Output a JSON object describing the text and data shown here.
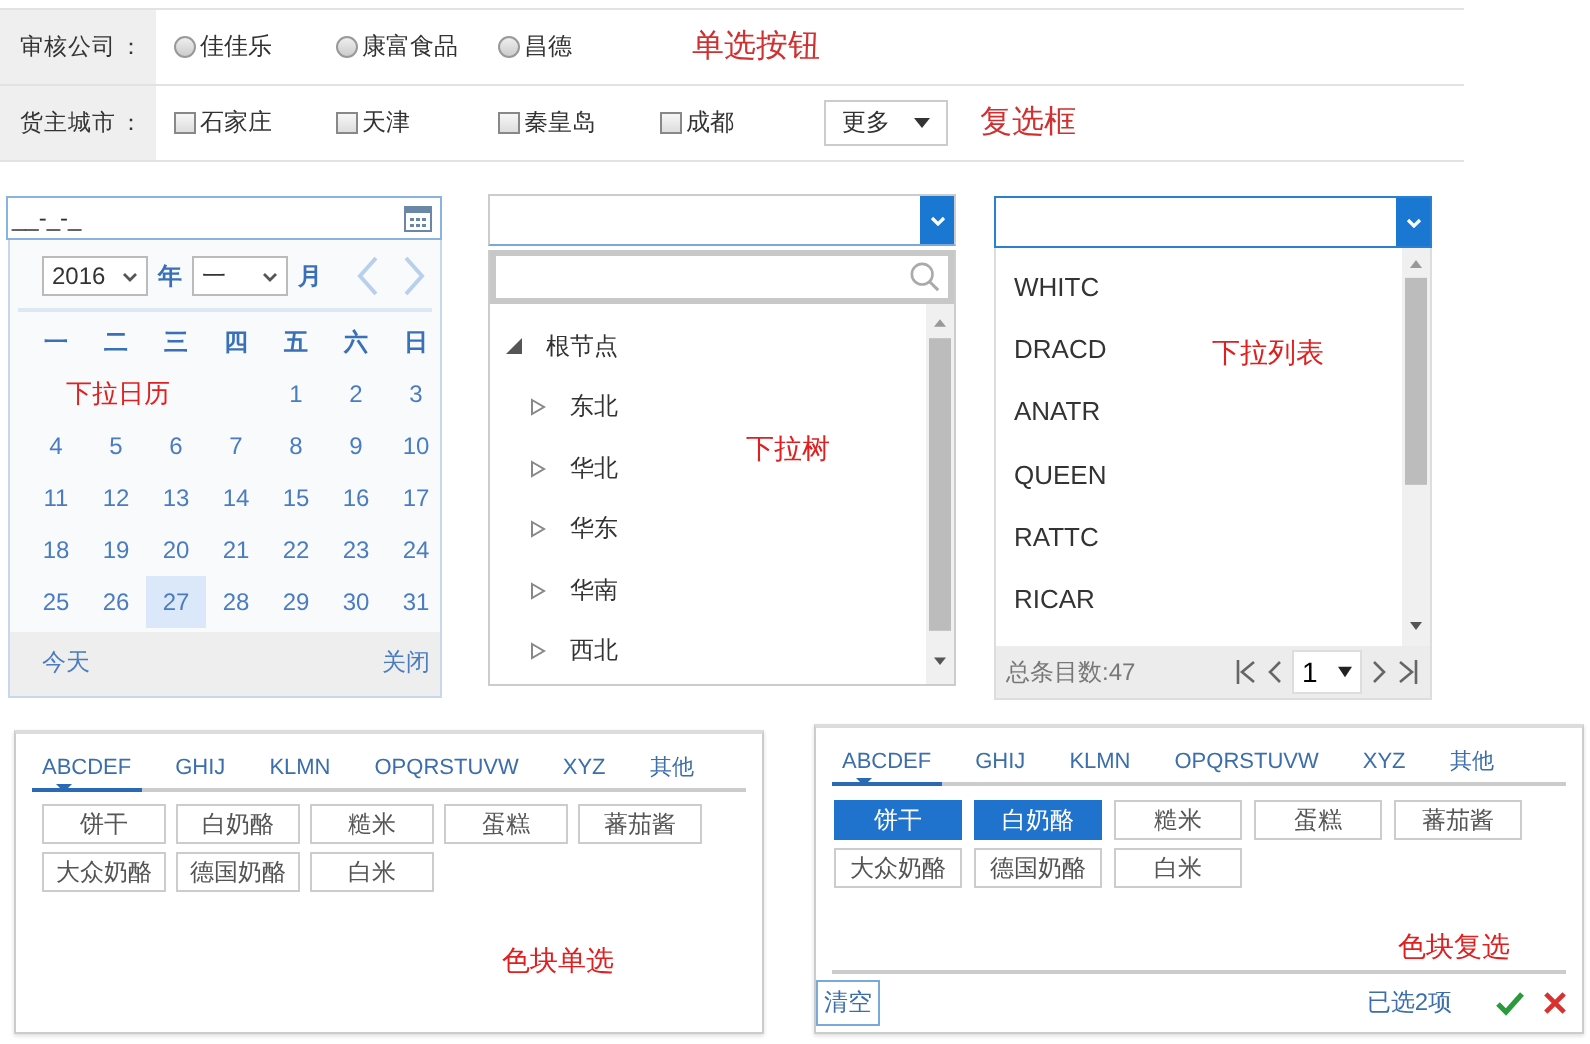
{
  "form": [
    {
      "label": "审核公司",
      "colon": "：",
      "kind": "radio",
      "options": [
        {
          "label": "佳佳乐",
          "selected": false
        },
        {
          "label": "康富食品",
          "selected": false
        },
        {
          "label": "昌德",
          "selected": false
        }
      ],
      "note": "单选按钮"
    },
    {
      "label": "货主城市",
      "colon": "：",
      "kind": "checkbox",
      "options": [
        {
          "label": "石家庄",
          "checked": false
        },
        {
          "label": "天津",
          "checked": false
        },
        {
          "label": "秦皇岛",
          "checked": false
        },
        {
          "label": "成都",
          "checked": false
        }
      ],
      "more": "更多",
      "note": "复选框"
    }
  ],
  "datepicker": {
    "value": "__-_-_",
    "year": "2016",
    "year_unit": "年",
    "month": "一",
    "month_unit": "月",
    "weekdays": [
      "一",
      "二",
      "三",
      "四",
      "五",
      "六",
      "日"
    ],
    "note": "下拉日历",
    "weeks": [
      [
        {
          "day": "1",
          "selected": false
        },
        {
          "day": "2",
          "selected": false
        },
        {
          "day": "3",
          "selected": false
        }
      ],
      [
        {
          "day": "4",
          "selected": false
        },
        {
          "day": "5",
          "selected": false
        },
        {
          "day": "6",
          "selected": false
        },
        {
          "day": "7",
          "selected": false
        },
        {
          "day": "8",
          "selected": false
        },
        {
          "day": "9",
          "selected": false
        },
        {
          "day": "10",
          "selected": false
        }
      ],
      [
        {
          "day": "11",
          "selected": false
        },
        {
          "day": "12",
          "selected": false
        },
        {
          "day": "13",
          "selected": false
        },
        {
          "day": "14",
          "selected": false
        },
        {
          "day": "15",
          "selected": false
        },
        {
          "day": "16",
          "selected": false
        },
        {
          "day": "17",
          "selected": false
        }
      ],
      [
        {
          "day": "18",
          "selected": false
        },
        {
          "day": "19",
          "selected": false
        },
        {
          "day": "20",
          "selected": false
        },
        {
          "day": "21",
          "selected": false
        },
        {
          "day": "22",
          "selected": false
        },
        {
          "day": "23",
          "selected": false
        },
        {
          "day": "24",
          "selected": false
        }
      ],
      [
        {
          "day": "25",
          "selected": false
        },
        {
          "day": "26",
          "selected": false
        },
        {
          "day": "27",
          "selected": true
        },
        {
          "day": "28",
          "selected": false
        },
        {
          "day": "29",
          "selected": false
        },
        {
          "day": "30",
          "selected": false
        },
        {
          "day": "31",
          "selected": false
        }
      ]
    ],
    "today": "今天",
    "close": "关闭"
  },
  "tree": {
    "note": "下拉树",
    "root": {
      "label": "根节点",
      "expanded": true,
      "children": [
        {
          "label": "东北",
          "expanded": false
        },
        {
          "label": "华北",
          "expanded": false
        },
        {
          "label": "华东",
          "expanded": false
        },
        {
          "label": "华南",
          "expanded": false
        },
        {
          "label": "西北",
          "expanded": false
        }
      ]
    }
  },
  "list": {
    "items": [
      "WHITC",
      "DRACD",
      "ANATR",
      "QUEEN",
      "RATTC",
      "RICAR"
    ],
    "note": "下拉列表",
    "total": "总条目数:47",
    "page": "1"
  },
  "block_panels": [
    {
      "kind": "single",
      "tabs": [
        {
          "label": "ABCDEF",
          "selected": true
        },
        {
          "label": "GHIJ",
          "selected": false
        },
        {
          "label": "KLMN",
          "selected": false
        },
        {
          "label": "OPQRSTUVW",
          "selected": false
        },
        {
          "label": "XYZ",
          "selected": false
        },
        {
          "label": "其他",
          "selected": false
        }
      ],
      "items": [
        {
          "label": "饼干",
          "selected": false
        },
        {
          "label": "白奶酪",
          "selected": false
        },
        {
          "label": "糙米",
          "selected": false
        },
        {
          "label": "蛋糕",
          "selected": false
        },
        {
          "label": "蕃茄酱",
          "selected": false
        },
        {
          "label": "大众奶酪",
          "selected": false
        },
        {
          "label": "德国奶酪",
          "selected": false
        },
        {
          "label": "白米",
          "selected": false
        }
      ],
      "note": "色块单选"
    },
    {
      "kind": "multi",
      "tabs": [
        {
          "label": "ABCDEF",
          "selected": true
        },
        {
          "label": "GHIJ",
          "selected": false
        },
        {
          "label": "KLMN",
          "selected": false
        },
        {
          "label": "OPQRSTUVW",
          "selected": false
        },
        {
          "label": "XYZ",
          "selected": false
        },
        {
          "label": "其他",
          "selected": false
        }
      ],
      "items": [
        {
          "label": "饼干",
          "selected": true
        },
        {
          "label": "白奶酪",
          "selected": true
        },
        {
          "label": "糙米",
          "selected": false
        },
        {
          "label": "蛋糕",
          "selected": false
        },
        {
          "label": "蕃茄酱",
          "selected": false
        },
        {
          "label": "大众奶酪",
          "selected": false
        },
        {
          "label": "德国奶酪",
          "selected": false
        },
        {
          "label": "白米",
          "selected": false
        }
      ],
      "note": "色块复选",
      "clear": "清空",
      "status": "已选2项"
    }
  ]
}
